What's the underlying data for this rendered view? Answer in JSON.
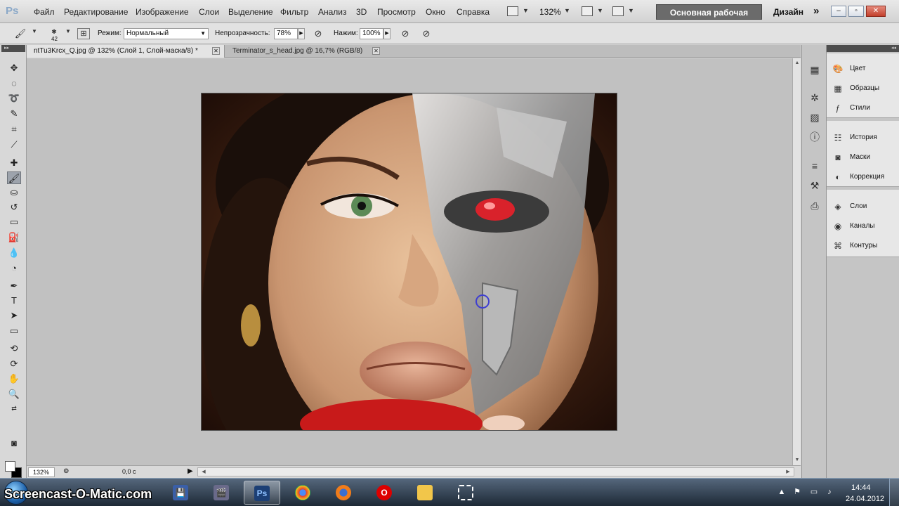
{
  "app": {
    "logo": "Ps"
  },
  "menu": [
    "Файл",
    "Редактирование",
    "Изображение",
    "Слои",
    "Выделение",
    "Фильтр",
    "Анализ",
    "3D",
    "Просмотр",
    "Окно",
    "Справка"
  ],
  "menubar": {
    "zoom": "132%",
    "workspace": "Основная рабочая среда",
    "design": "Дизайн",
    "more": "»"
  },
  "options": {
    "brush_size": "42",
    "mode_label": "Режим:",
    "mode_value": "Нормальный",
    "opacity_label": "Непрозрачность:",
    "opacity_value": "78%",
    "flow_label": "Нажим:",
    "flow_value": "100%"
  },
  "tabs": [
    {
      "label": "ntTu3Krcx_Q.jpg @ 132% (Слой 1, Слой-маска/8) *",
      "active": true
    },
    {
      "label": "Terminator_s_head.jpg @ 16,7% (RGB/8)",
      "active": false
    }
  ],
  "status": {
    "zoom": "132%",
    "info": "0,0 с"
  },
  "panels": [
    {
      "label": "Цвет",
      "icon": "color-icon"
    },
    {
      "label": "Образцы",
      "icon": "swatches-icon"
    },
    {
      "label": "Стили",
      "icon": "styles-icon"
    },
    {
      "label": "История",
      "icon": "history-icon"
    },
    {
      "label": "Маски",
      "icon": "masks-icon"
    },
    {
      "label": "Коррекция",
      "icon": "adjustments-icon"
    },
    {
      "label": "Слои",
      "icon": "layers-icon"
    },
    {
      "label": "Каналы",
      "icon": "channels-icon"
    },
    {
      "label": "Контуры",
      "icon": "paths-icon"
    }
  ],
  "taskbar": {
    "watermark": "Screencast-O-Matic.com",
    "time": "14:44",
    "date": "24.04.2012",
    "apps": [
      "save-app",
      "video-editor-app",
      "photoshop-app",
      "chrome-app",
      "firefox-app",
      "opera-app",
      "explorer-app",
      "snipping-app"
    ]
  },
  "colors": {
    "workspace_btn": "#6b6b6b",
    "panel_bg": "#c5c5c5",
    "canvas_bg": "#c1c1c1"
  }
}
